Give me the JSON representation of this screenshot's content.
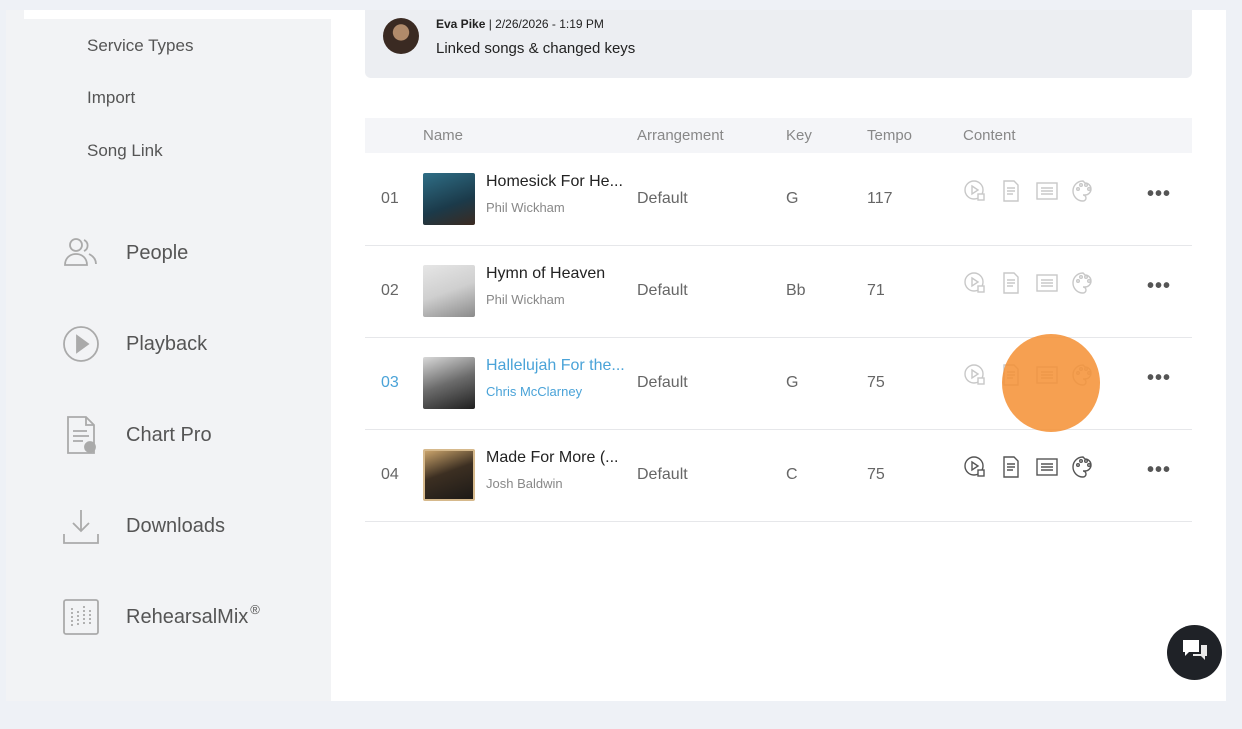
{
  "sidebar": {
    "sub_items": [
      "Service Types",
      "Import",
      "Song Link"
    ],
    "nav": [
      {
        "label": "People",
        "icon": "people-icon"
      },
      {
        "label": "Playback",
        "icon": "play-circle-icon"
      },
      {
        "label": "Chart Pro",
        "icon": "chart-doc-icon"
      },
      {
        "label": "Downloads",
        "icon": "download-icon"
      },
      {
        "label": "RehearsalMix",
        "icon": "mixer-icon",
        "sup": "®"
      }
    ]
  },
  "comment": {
    "author": "Eva Pike",
    "timestamp": " | 2/26/2026 - 1:19 PM",
    "text": "Linked songs & changed keys"
  },
  "table": {
    "headers": {
      "name": "Name",
      "arrangement": "Arrangement",
      "key": "Key",
      "tempo": "Tempo",
      "content": "Content"
    },
    "rows": [
      {
        "num": "01",
        "title": "Homesick For He...",
        "artist": "Phil Wickham",
        "arrangement": "Default",
        "key": "G",
        "tempo": "117",
        "active": false,
        "icon_color": "#c8c8c8"
      },
      {
        "num": "02",
        "title": "Hymn of Heaven",
        "artist": "Phil Wickham",
        "arrangement": "Default",
        "key": "Bb",
        "tempo": "71",
        "active": false,
        "icon_color": "#c8c8c8"
      },
      {
        "num": "03",
        "title": "Hallelujah For the...",
        "artist": "Chris McClarney",
        "arrangement": "Default",
        "key": "G",
        "tempo": "75",
        "active": true,
        "icon_color": "#c8c8c8"
      },
      {
        "num": "04",
        "title": "Made For More (...",
        "artist": "Josh Baldwin",
        "arrangement": "Default",
        "key": "C",
        "tempo": "75",
        "active": false,
        "icon_color": "#555555"
      }
    ],
    "more_label": "•••"
  },
  "colors": {
    "accent": "#4aa3d8",
    "highlight": "#f58f32"
  }
}
